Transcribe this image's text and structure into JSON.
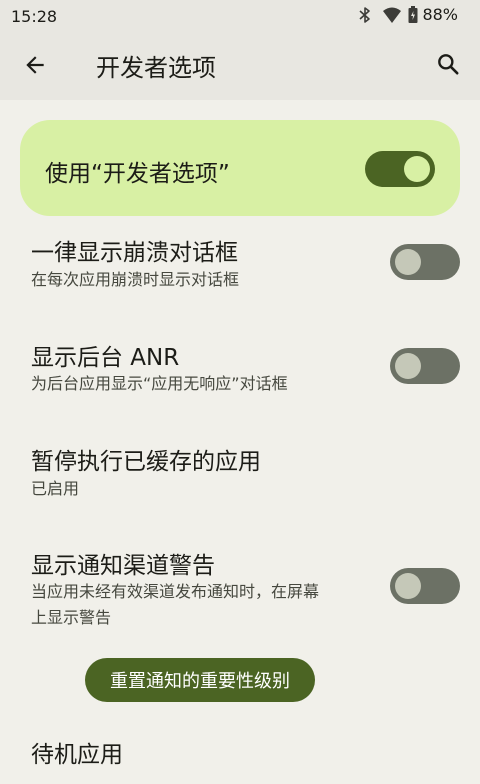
{
  "status_bar": {
    "time": "15:28",
    "battery": "88%",
    "icons": [
      "bluetooth-icon",
      "wifi-icon",
      "battery-icon"
    ]
  },
  "app_bar": {
    "title": "开发者选项",
    "back_icon": "arrow-back-icon",
    "search_icon": "search-icon"
  },
  "master_switch": {
    "label": "使用“开发者选项”",
    "checked": true
  },
  "preferences": [
    {
      "title": "一律显示崩溃对话框",
      "summary": "在每次应用崩溃时显示对话框",
      "toggle": false
    },
    {
      "title": "显示后台 ANR",
      "summary": "为后台应用显示“应用无响应”对话框",
      "toggle": false
    },
    {
      "title": "暂停执行已缓存的应用",
      "summary": "已启用"
    },
    {
      "title": "显示通知渠道警告",
      "summary_line1": "当应用未经有效渠道发布通知时，在屏幕",
      "summary_line2": "上显示警告",
      "toggle": false
    },
    {
      "title": "待机应用"
    }
  ],
  "reset_button": {
    "label": "重置通知的重要性级别"
  },
  "colors": {
    "accent": "#4b6423",
    "card": "#d8f0a4",
    "background": "#f1f0ea",
    "toggle_off": "#6c7165"
  }
}
